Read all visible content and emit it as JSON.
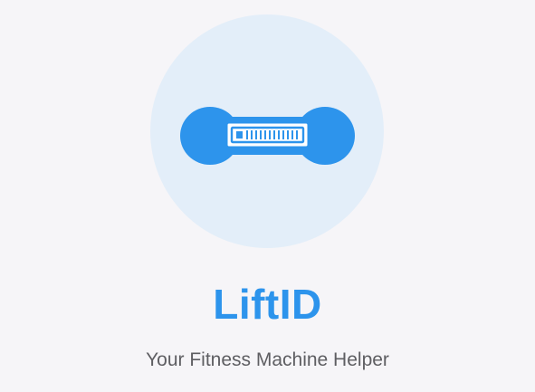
{
  "app": {
    "title": "LiftID",
    "subtitle": "Your Fitness Machine Helper"
  },
  "logo": {
    "icon": "dumbbell-barcode-icon",
    "circle_color": "#e3eef9",
    "icon_color": "#2d94ec",
    "inner_color": "#ffffff"
  },
  "colors": {
    "background": "#f6f5f8",
    "accent": "#2d94ec",
    "subtitle": "#5e5e62"
  }
}
